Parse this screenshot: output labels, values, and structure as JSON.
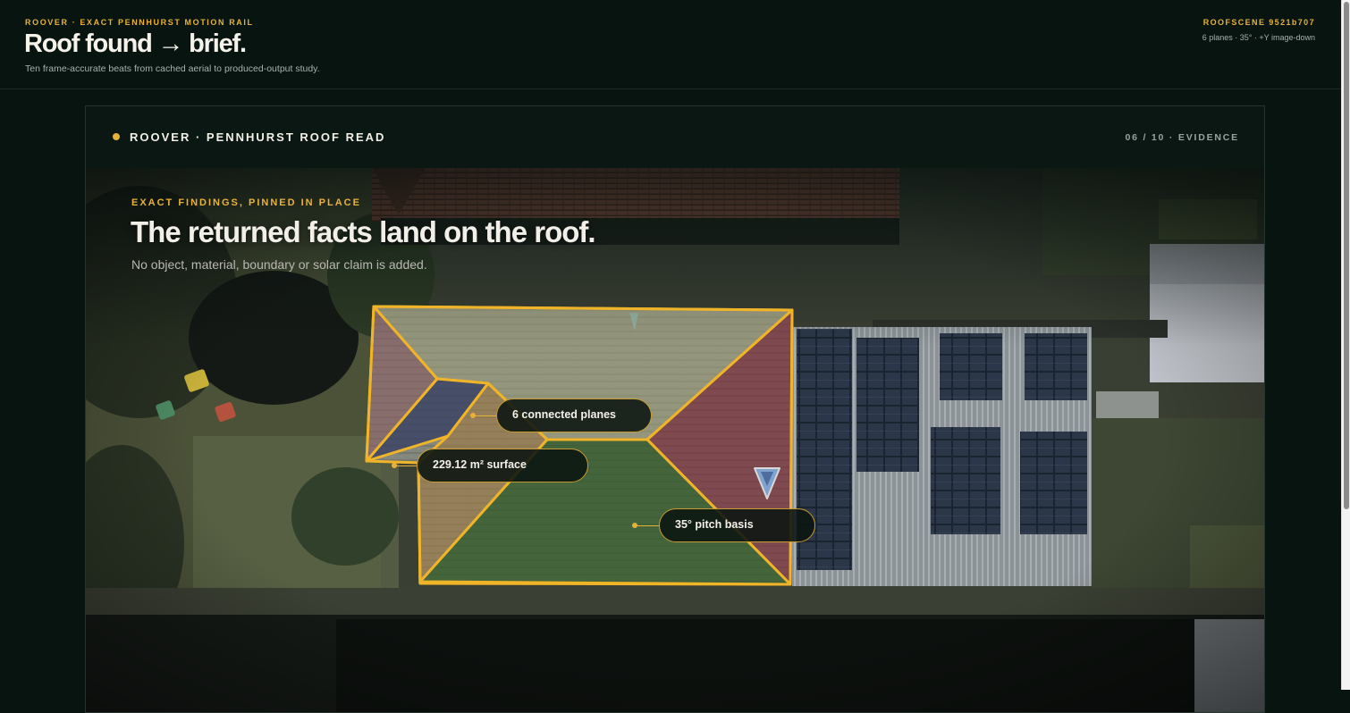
{
  "header": {
    "eyebrow": "ROOVER · EXACT PENNHURST MOTION RAIL",
    "title": "Roof found → brief.",
    "subtitle": "Ten frame-accurate beats from cached aerial to produced-output study.",
    "scene_id": "ROOFSCENE 9521b707",
    "scene_meta": "6 planes · 35° · +Y image-down"
  },
  "card": {
    "title": "ROOVER · PENNHURST ROOF READ",
    "step": "06 / 10 · EVIDENCE"
  },
  "overlay": {
    "eyebrow": "EXACT FINDINGS, PINNED IN PLACE",
    "title": "The returned facts land on the roof.",
    "subtitle": "No object, material, boundary or solar claim is added."
  },
  "callouts": {
    "planes": "6 connected planes",
    "surface": "229.12 m² surface",
    "pitch": "35° pitch basis"
  },
  "colors": {
    "accent": "#e8b23a",
    "background": "#071410",
    "roof_outline": "#f0b429"
  },
  "icons": {
    "north_marker": "north-arrow-icon"
  }
}
